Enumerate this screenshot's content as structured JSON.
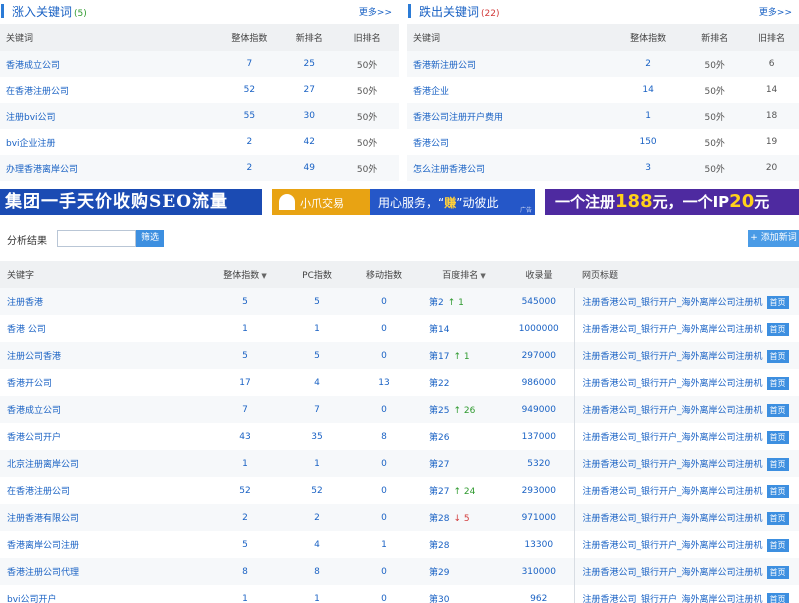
{
  "rise_panel": {
    "title": "涨入关键词",
    "count": "(5)",
    "more": "更多>>",
    "headers": [
      "关键词",
      "整体指数",
      "新排名",
      "旧排名"
    ],
    "rows": [
      {
        "keyword": "香港成立公司",
        "index": "7",
        "new_rank": "25",
        "old_rank": "50外"
      },
      {
        "keyword": "在香港注册公司",
        "index": "52",
        "new_rank": "27",
        "old_rank": "50外"
      },
      {
        "keyword": "注册bvi公司",
        "index": "55",
        "new_rank": "30",
        "old_rank": "50外"
      },
      {
        "keyword": "bvi企业注册",
        "index": "2",
        "new_rank": "42",
        "old_rank": "50外"
      },
      {
        "keyword": "办理香港离岸公司",
        "index": "2",
        "new_rank": "49",
        "old_rank": "50外"
      }
    ]
  },
  "drop_panel": {
    "title": "跌出关键词",
    "count": "(22)",
    "more": "更多>>",
    "headers": [
      "关键词",
      "整体指数",
      "新排名",
      "旧排名"
    ],
    "rows": [
      {
        "keyword": "香港新注册公司",
        "index": "2",
        "new_rank": "50外",
        "old_rank": "6"
      },
      {
        "keyword": "香港企业",
        "index": "14",
        "new_rank": "50外",
        "old_rank": "14"
      },
      {
        "keyword": "香港公司注册开户费用",
        "index": "1",
        "new_rank": "50外",
        "old_rank": "18"
      },
      {
        "keyword": "香港公司",
        "index": "150",
        "new_rank": "50外",
        "old_rank": "19"
      },
      {
        "keyword": "怎么注册香港公司",
        "index": "3",
        "new_rank": "50外",
        "old_rank": "20"
      }
    ]
  },
  "banners": {
    "b1": "集团一手天价收购SEO流量",
    "b2_logo": "小爪交易",
    "b2_pre": "用心服务，“",
    "b2_hl": "赚",
    "b2_post": "”动彼此",
    "b2_ad": "广告",
    "b3_pre": "一个注册",
    "b3_n1": "188",
    "b3_mid": "元，一个IP",
    "b3_n2": "20",
    "b3_post": "元"
  },
  "toolbar": {
    "label": "分析结果",
    "filter_btn": "筛选",
    "add_btn": "+ 添加新词",
    "input_value": ""
  },
  "main_table": {
    "headers": {
      "keyword": "关键字",
      "index": "整体指数",
      "pc": "PC指数",
      "mobile": "移动指数",
      "rank": "百度排名",
      "indexed": "收录量",
      "title": "网页标题"
    },
    "sort_marks": {
      "index": "▼",
      "rank": "▼"
    },
    "home_label": "首页",
    "rows": [
      {
        "keyword": "注册香港",
        "index": "5",
        "pc": "5",
        "mobile": "0",
        "rank": "第2",
        "change": "↑ 1",
        "dir": "up",
        "indexed": "545000",
        "title": "注册香港公司_银行开户_海外离岸公司注册机"
      },
      {
        "keyword": "香港 公司",
        "index": "1",
        "pc": "1",
        "mobile": "0",
        "rank": "第14",
        "change": "",
        "dir": "",
        "indexed": "1000000",
        "title": "注册香港公司_银行开户_海外离岸公司注册机"
      },
      {
        "keyword": "注册公司香港",
        "index": "5",
        "pc": "5",
        "mobile": "0",
        "rank": "第17",
        "change": "↑ 1",
        "dir": "up",
        "indexed": "297000",
        "title": "注册香港公司_银行开户_海外离岸公司注册机"
      },
      {
        "keyword": "香港开公司",
        "index": "17",
        "pc": "4",
        "mobile": "13",
        "rank": "第22",
        "change": "",
        "dir": "",
        "indexed": "986000",
        "title": "注册香港公司_银行开户_海外离岸公司注册机"
      },
      {
        "keyword": "香港成立公司",
        "index": "7",
        "pc": "7",
        "mobile": "0",
        "rank": "第25",
        "change": "↑ 26",
        "dir": "up",
        "indexed": "949000",
        "title": "注册香港公司_银行开户_海外离岸公司注册机"
      },
      {
        "keyword": "香港公司开户",
        "index": "43",
        "pc": "35",
        "mobile": "8",
        "rank": "第26",
        "change": "",
        "dir": "",
        "indexed": "137000",
        "title": "注册香港公司_银行开户_海外离岸公司注册机"
      },
      {
        "keyword": "北京注册离岸公司",
        "index": "1",
        "pc": "1",
        "mobile": "0",
        "rank": "第27",
        "change": "",
        "dir": "",
        "indexed": "5320",
        "title": "注册香港公司_银行开户_海外离岸公司注册机"
      },
      {
        "keyword": "在香港注册公司",
        "index": "52",
        "pc": "52",
        "mobile": "0",
        "rank": "第27",
        "change": "↑ 24",
        "dir": "up",
        "indexed": "293000",
        "title": "注册香港公司_银行开户_海外离岸公司注册机"
      },
      {
        "keyword": "注册香港有限公司",
        "index": "2",
        "pc": "2",
        "mobile": "0",
        "rank": "第28",
        "change": "↓ 5",
        "dir": "down",
        "indexed": "971000",
        "title": "注册香港公司_银行开户_海外离岸公司注册机"
      },
      {
        "keyword": "香港离岸公司注册",
        "index": "5",
        "pc": "4",
        "mobile": "1",
        "rank": "第28",
        "change": "",
        "dir": "",
        "indexed": "13300",
        "title": "注册香港公司_银行开户_海外离岸公司注册机"
      },
      {
        "keyword": "香港注册公司代理",
        "index": "8",
        "pc": "8",
        "mobile": "0",
        "rank": "第29",
        "change": "",
        "dir": "",
        "indexed": "310000",
        "title": "注册香港公司_银行开户_海外离岸公司注册机"
      },
      {
        "keyword": "bvi公司开户",
        "index": "1",
        "pc": "1",
        "mobile": "0",
        "rank": "第30",
        "change": "",
        "dir": "",
        "indexed": "962",
        "title": "注册香港公司_银行开户_海外离岸公司注册机"
      }
    ]
  }
}
